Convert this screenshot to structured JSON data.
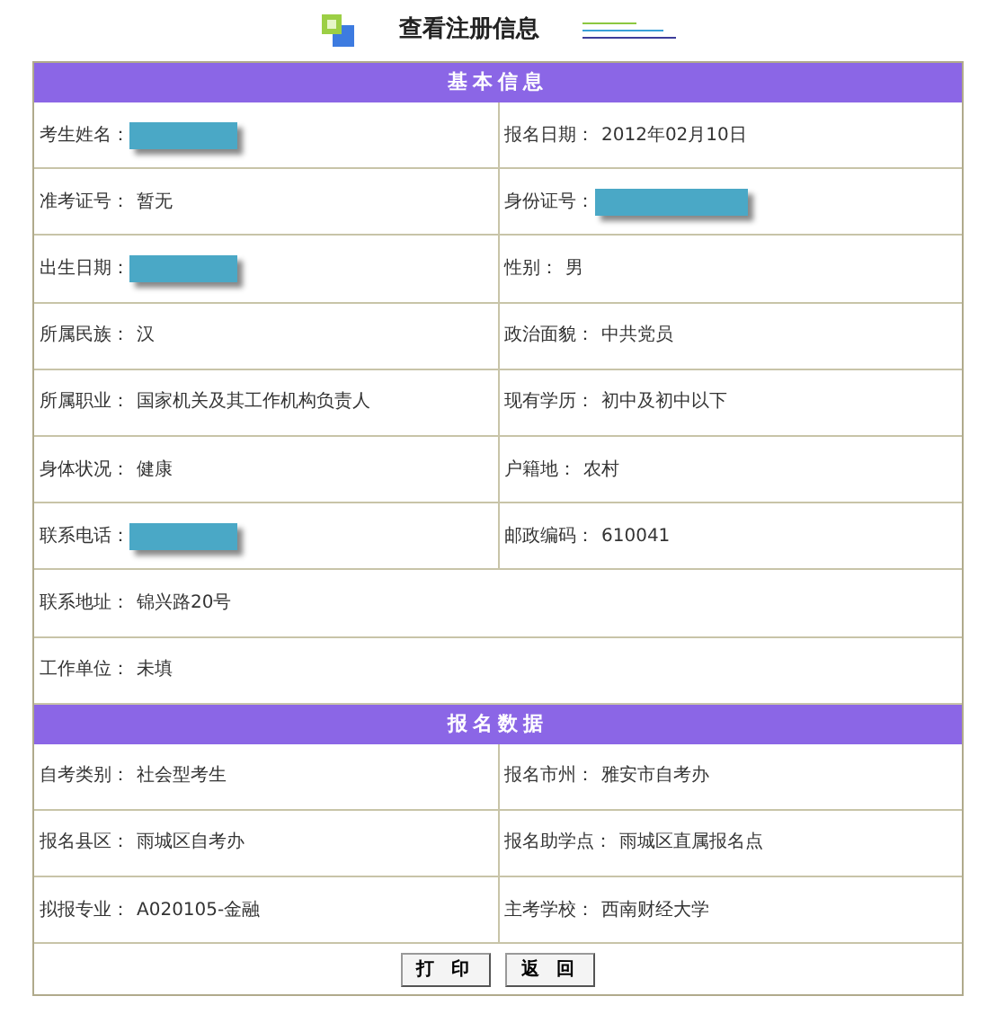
{
  "title": "查看注册信息",
  "sections": [
    {
      "heading": "基本信息",
      "rows": [
        [
          {
            "label": "考生姓名：",
            "redacted": true
          },
          {
            "label": "报名日期：",
            "value": "2012年02月10日"
          }
        ],
        [
          {
            "label": "准考证号：",
            "value": "暂无"
          },
          {
            "label": "身份证号：",
            "redacted": true
          }
        ],
        [
          {
            "label": "出生日期：",
            "redacted": true
          },
          {
            "label": "性别：",
            "value": "男"
          }
        ],
        [
          {
            "label": "所属民族：",
            "value": "汉"
          },
          {
            "label": "政治面貌：",
            "value": "中共党员"
          }
        ],
        [
          {
            "label": "所属职业：",
            "value": "国家机关及其工作机构负责人"
          },
          {
            "label": "现有学历：",
            "value": "初中及初中以下"
          }
        ],
        [
          {
            "label": "身体状况：",
            "value": "健康"
          },
          {
            "label": "户籍地：",
            "value": "农村"
          }
        ],
        [
          {
            "label": "联系电话：",
            "redacted": true
          },
          {
            "label": "邮政编码：",
            "value": "610041"
          }
        ],
        [
          {
            "label": "联系地址：",
            "value": "锦兴路20号"
          }
        ],
        [
          {
            "label": "工作单位：",
            "value": "未填"
          }
        ]
      ]
    },
    {
      "heading": "报名数据",
      "rows": [
        [
          {
            "label": "自考类别：",
            "value": "社会型考生"
          },
          {
            "label": "报名市州：",
            "value": "雅安市自考办"
          }
        ],
        [
          {
            "label": "报名县区：",
            "value": "雨城区自考办"
          },
          {
            "label": "报名助学点：",
            "value": "雨城区直属报名点"
          }
        ],
        [
          {
            "label": "拟报专业：",
            "value": "A020105-金融"
          },
          {
            "label": "主考学校：",
            "value": "西南财经大学"
          }
        ]
      ]
    }
  ],
  "buttons": [
    "打 印",
    "返 回"
  ]
}
